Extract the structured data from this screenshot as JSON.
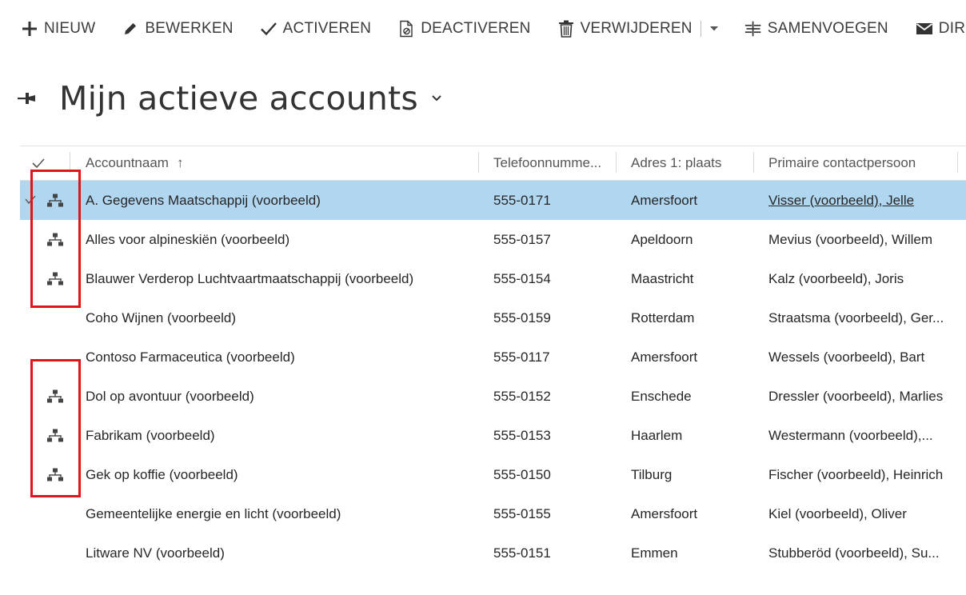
{
  "toolbar": {
    "new_label": "NIEUW",
    "edit_label": "BEWERKEN",
    "activate_label": "ACTIVEREN",
    "deactivate_label": "DEACTIVEREN",
    "delete_label": "VERWIJDEREN",
    "merge_label": "SAMENVOEGEN",
    "direct_label": "DIRECT"
  },
  "view": {
    "title": "Mijn actieve accounts"
  },
  "grid": {
    "columns": {
      "name": "Accountnaam",
      "phone": "Telefoonnumme...",
      "city": "Adres 1: plaats",
      "contact": "Primaire contactpersoon"
    },
    "sort_arrow": "↑",
    "rows": [
      {
        "name": "A. Gegevens Maatschappij (voorbeeld)",
        "phone": "555-0171",
        "city": "Amersfoort",
        "contact": "Visser (voorbeeld), Jelle"
      },
      {
        "name": "Alles voor alpineskiën (voorbeeld)",
        "phone": "555-0157",
        "city": "Apeldoorn",
        "contact": "Mevius (voorbeeld), Willem"
      },
      {
        "name": "Blauwer Verderop Luchtvaartmaatschappij (voorbeeld)",
        "phone": "555-0154",
        "city": "Maastricht",
        "contact": "Kalz (voorbeeld), Joris"
      },
      {
        "name": "Coho Wijnen (voorbeeld)",
        "phone": "555-0159",
        "city": "Rotterdam",
        "contact": "Straatsma (voorbeeld), Ger..."
      },
      {
        "name": "Contoso Farmaceutica (voorbeeld)",
        "phone": "555-0117",
        "city": "Amersfoort",
        "contact": "Wessels (voorbeeld), Bart"
      },
      {
        "name": "Dol op avontuur (voorbeeld)",
        "phone": "555-0152",
        "city": "Enschede",
        "contact": "Dressler (voorbeeld), Marlies"
      },
      {
        "name": "Fabrikam (voorbeeld)",
        "phone": "555-0153",
        "city": "Haarlem",
        "contact": "Westermann (voorbeeld),..."
      },
      {
        "name": "Gek op koffie (voorbeeld)",
        "phone": "555-0150",
        "city": "Tilburg",
        "contact": "Fischer (voorbeeld), Heinrich"
      },
      {
        "name": "Gemeentelijke energie en licht (voorbeeld)",
        "phone": "555-0155",
        "city": "Amersfoort",
        "contact": "Kiel (voorbeeld), Oliver"
      },
      {
        "name": "Litware NV (voorbeeld)",
        "phone": "555-0151",
        "city": "Emmen",
        "contact": "Stubberöd (voorbeeld), Su..."
      }
    ]
  },
  "colors": {
    "selected_row": "#b1d6f0",
    "highlight_box": "#e0141b"
  }
}
